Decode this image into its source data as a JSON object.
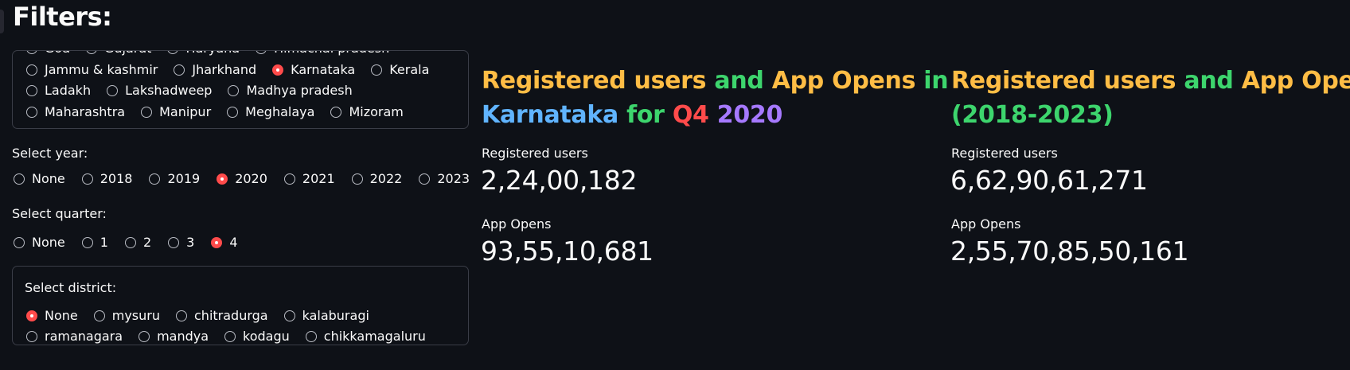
{
  "colors": {
    "orange": "#ffbd45",
    "green": "#3dd56d",
    "blue": "#60b4ff",
    "red": "#ff4b4b",
    "purple": "#a679ff",
    "accent": "#ff4b4b",
    "background": "#0e1117"
  },
  "filters_title": "Filters:",
  "states": {
    "rows": [
      [
        {
          "label": "Goa",
          "selected": false
        },
        {
          "label": "Gujarat",
          "selected": false
        },
        {
          "label": "Haryana",
          "selected": false
        },
        {
          "label": "Himachal pradesh",
          "selected": false
        }
      ],
      [
        {
          "label": "Jammu & kashmir",
          "selected": false
        },
        {
          "label": "Jharkhand",
          "selected": false
        },
        {
          "label": "Karnataka",
          "selected": true
        },
        {
          "label": "Kerala",
          "selected": false
        }
      ],
      [
        {
          "label": "Ladakh",
          "selected": false
        },
        {
          "label": "Lakshadweep",
          "selected": false
        },
        {
          "label": "Madhya pradesh",
          "selected": false
        }
      ],
      [
        {
          "label": "Maharashtra",
          "selected": false
        },
        {
          "label": "Manipur",
          "selected": false
        },
        {
          "label": "Meghalaya",
          "selected": false
        },
        {
          "label": "Mizoram",
          "selected": false
        }
      ]
    ]
  },
  "year": {
    "label": "Select year:",
    "options": [
      {
        "label": "None",
        "selected": false
      },
      {
        "label": "2018",
        "selected": false
      },
      {
        "label": "2019",
        "selected": false
      },
      {
        "label": "2020",
        "selected": true
      },
      {
        "label": "2021",
        "selected": false
      },
      {
        "label": "2022",
        "selected": false
      },
      {
        "label": "2023",
        "selected": false
      }
    ]
  },
  "quarter": {
    "label": "Select quarter:",
    "options": [
      {
        "label": "None",
        "selected": false
      },
      {
        "label": "1",
        "selected": false
      },
      {
        "label": "2",
        "selected": false
      },
      {
        "label": "3",
        "selected": false
      },
      {
        "label": "4",
        "selected": true
      }
    ]
  },
  "district": {
    "label": "Select district:",
    "rows": [
      [
        {
          "label": "None",
          "selected": true
        },
        {
          "label": "mysuru",
          "selected": false
        },
        {
          "label": "chitradurga",
          "selected": false
        },
        {
          "label": "kalaburagi",
          "selected": false
        }
      ],
      [
        {
          "label": "ramanagara",
          "selected": false
        },
        {
          "label": "mandya",
          "selected": false
        },
        {
          "label": "kodagu",
          "selected": false
        },
        {
          "label": "chikkamagaluru",
          "selected": false
        }
      ]
    ]
  },
  "state_panel": {
    "headline": {
      "line1": [
        {
          "text": "Registered users",
          "color": "orange"
        },
        {
          "text": " and ",
          "color": "green"
        },
        {
          "text": "App Opens",
          "color": "orange"
        },
        {
          "text": " in",
          "color": "green"
        }
      ],
      "line2": [
        {
          "text": "Karnataka",
          "color": "blue"
        },
        {
          "text": " for ",
          "color": "green"
        },
        {
          "text": "Q4",
          "color": "red"
        },
        {
          "text": " 2020",
          "color": "purple"
        }
      ]
    },
    "registered_label": "Registered users",
    "registered_value": "2,24,00,182",
    "appopens_label": "App Opens",
    "appopens_value": "93,55,10,681"
  },
  "overall_panel": {
    "headline": {
      "line1": [
        {
          "text": "Registered users",
          "color": "orange"
        },
        {
          "text": " and ",
          "color": "green"
        },
        {
          "text": "App Opens",
          "color": "orange"
        }
      ],
      "line2": [
        {
          "text": "(2018-2023)",
          "color": "green"
        }
      ]
    },
    "registered_label": "Registered users",
    "registered_value": "6,62,90,61,271",
    "appopens_label": "App Opens",
    "appopens_value": "2,55,70,85,50,161"
  }
}
